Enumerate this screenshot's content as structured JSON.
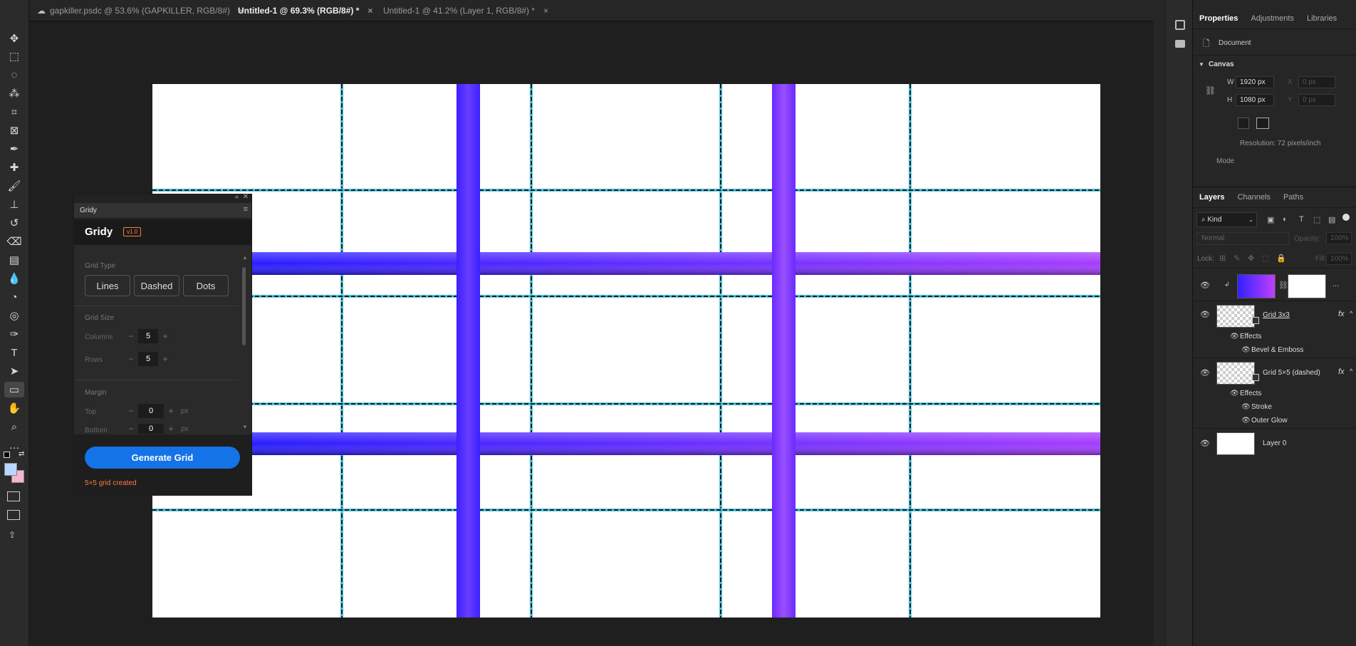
{
  "tabs": [
    {
      "label": "gapkiller.psdc @ 53.6% (GAPKILLER, RGB/8#)",
      "cloud": true
    },
    {
      "label": "Untitled-1 @ 69.3% (RGB/8#) *",
      "active": true
    },
    {
      "label": "Untitled-1 @ 41.2% (Layer 1, RGB/8#) *"
    }
  ],
  "tab_close": "×",
  "tools": [
    "move-icon",
    "marquee-icon",
    "lasso-icon",
    "magic-wand-icon",
    "crop-icon",
    "frame-icon",
    "eyedropper-icon",
    "spot-heal-icon",
    "brush-icon",
    "stamp-icon",
    "history-brush-icon",
    "eraser-icon",
    "gradient-icon",
    "blur-icon",
    "dodge-icon",
    "sponge-icon",
    "pen-icon",
    "type-icon",
    "path-select-icon",
    "rectangle-icon",
    "hand-icon",
    "zoom-icon",
    "more-icon"
  ],
  "colors": {
    "foreground": "#b9d7ff",
    "background": "#f4b6d2",
    "accent": "#1473e6",
    "grid_purple_start": "#2a1cff",
    "grid_purple_end": "#a13cff",
    "dash": "#3ab3c9"
  },
  "properties": {
    "tabs": [
      "Properties",
      "Adjustments",
      "Libraries"
    ],
    "doc_label": "Document",
    "canvas_label": "Canvas",
    "w_label": "W",
    "w_value": "1920 px",
    "h_label": "H",
    "h_value": "1080 px",
    "x_label": "X",
    "x_value": "0 px",
    "y_label": "Y",
    "y_value": "0 px",
    "resolution": "Resolution: 72 pixels/inch",
    "mode_label": "Mode"
  },
  "layers_panel": {
    "tabs": [
      "Layers",
      "Channels",
      "Paths"
    ],
    "kind": "Kind",
    "blend": "Normal",
    "opacity_label": "Opacity:",
    "opacity_value": "100%",
    "lock_label": "Lock:",
    "fill_label": "Fill:",
    "fill_value": "100%",
    "more": "...",
    "fx": "fx",
    "layers": [
      {
        "name": "Grid 3x3",
        "effects_label": "Effects",
        "effects": [
          "Bevel & Emboss"
        ]
      },
      {
        "name": "Grid 5×5 (dashed)",
        "effects_label": "Effects",
        "effects": [
          "Stroke",
          "Outer Glow"
        ]
      },
      {
        "name": "Layer 0"
      }
    ]
  },
  "gridy": {
    "tab": "Gridy",
    "title": "Gridy",
    "version": "v1.0",
    "grid_type_label": "Grid Type",
    "types": [
      "Lines",
      "Dashed",
      "Dots"
    ],
    "grid_size_label": "Grid Size",
    "columns_label": "Columns",
    "columns_value": "5",
    "rows_label": "Rows",
    "rows_value": "5",
    "margin_label": "Margin",
    "top_label": "Top",
    "top_value": "0",
    "bottom_label": "Bottom",
    "bottom_value": "0",
    "unit": "px",
    "minus": "−",
    "plus": "+",
    "generate": "Generate Grid",
    "status": "5×5 grid created"
  }
}
